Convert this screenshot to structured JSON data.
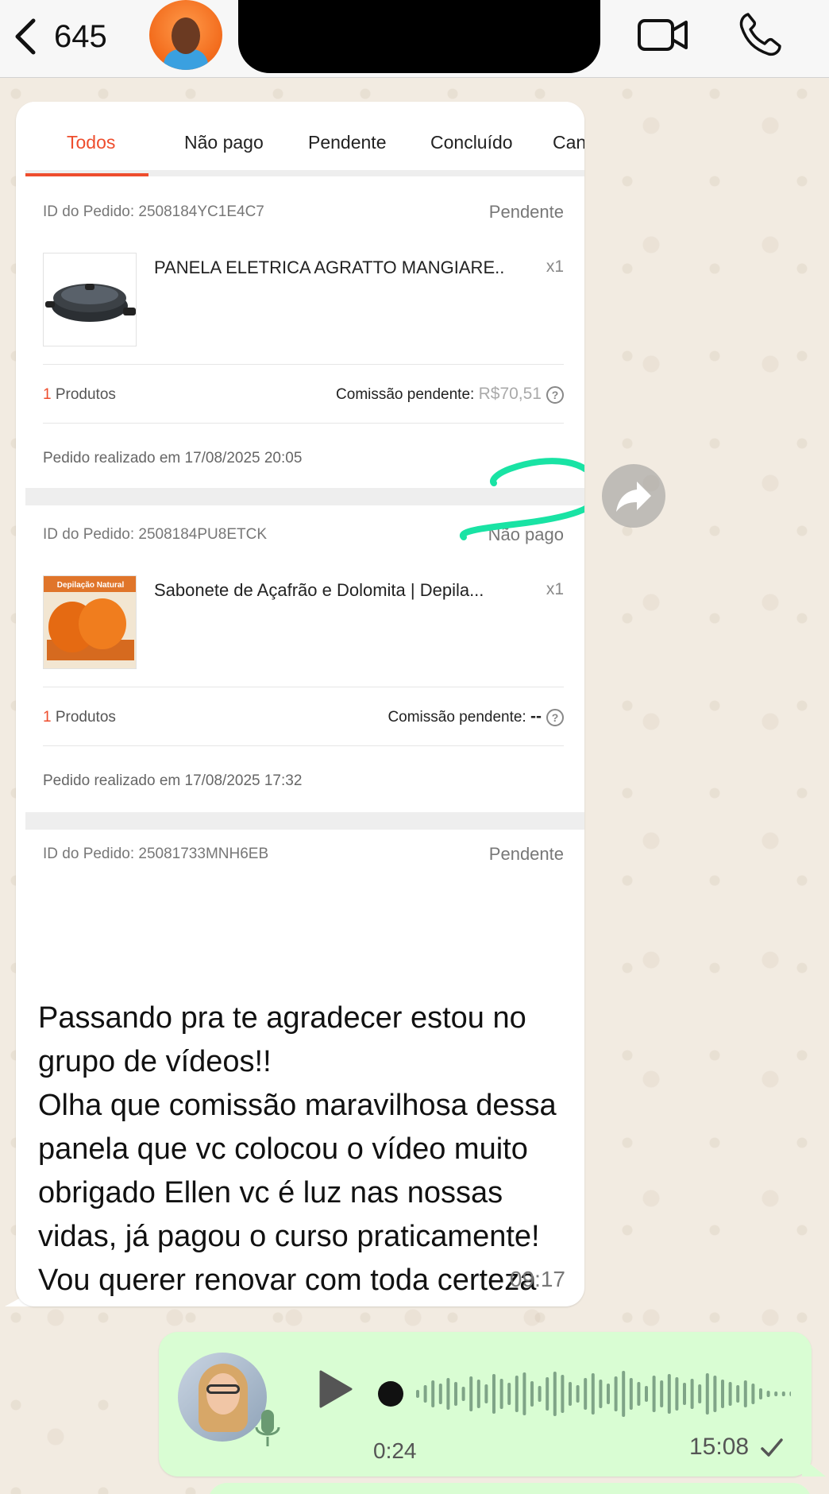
{
  "header": {
    "unread_count": "645",
    "contact_name_fragment": "+",
    "contact_status_fragment": "v"
  },
  "order_tabs": [
    "Todos",
    "Não pago",
    "Pendente",
    "Concluído",
    "Canc"
  ],
  "orders": [
    {
      "id": "ID do Pedido: 2508184YC1E4C7",
      "status": "Pendente",
      "product": "PANELA ELETRICA AGRATTO MANGIARE...",
      "qty": "x1",
      "count_num": "1",
      "count_label": " Produtos",
      "commission_label": "Comissão pendente: ",
      "commission_value": "R$70,51",
      "date": "Pedido realizado em 17/08/2025 20:05"
    },
    {
      "id": "ID do Pedido: 2508184PU8ETCK",
      "status": "Não pago",
      "product": "Sabonete de Açafrão e Dolomita | Depila...",
      "product_image_label": "Depilação Natural",
      "qty": "x1",
      "count_num": "1",
      "count_label": " Produtos",
      "commission_label": "Comissão pendente: ",
      "commission_value": "--",
      "date": "Pedido realizado em 17/08/2025 17:32"
    },
    {
      "id": "ID do Pedido: 25081733MNH6EB",
      "status": "Pendente"
    }
  ],
  "help_glyph": "?",
  "message_in": {
    "caption": "Passando pra te agradecer estou no grupo de vídeos!!\nOlha que comissão maravilhosa dessa panela que vc colocou o vídeo muito obrigado Ellen vc é luz nas nossas vidas, já pagou o curso praticamente!\nVou querer renovar com toda certeza 🙌🤩🤩🤩",
    "time": "09:17"
  },
  "message_out": {
    "duration": "0:24",
    "time": "15:08",
    "progress": 0
  },
  "colors": {
    "accent_orange": "#ee4d2d",
    "outgoing_bubble": "#d9fdd3",
    "annotation_green": "#19e3a4"
  }
}
